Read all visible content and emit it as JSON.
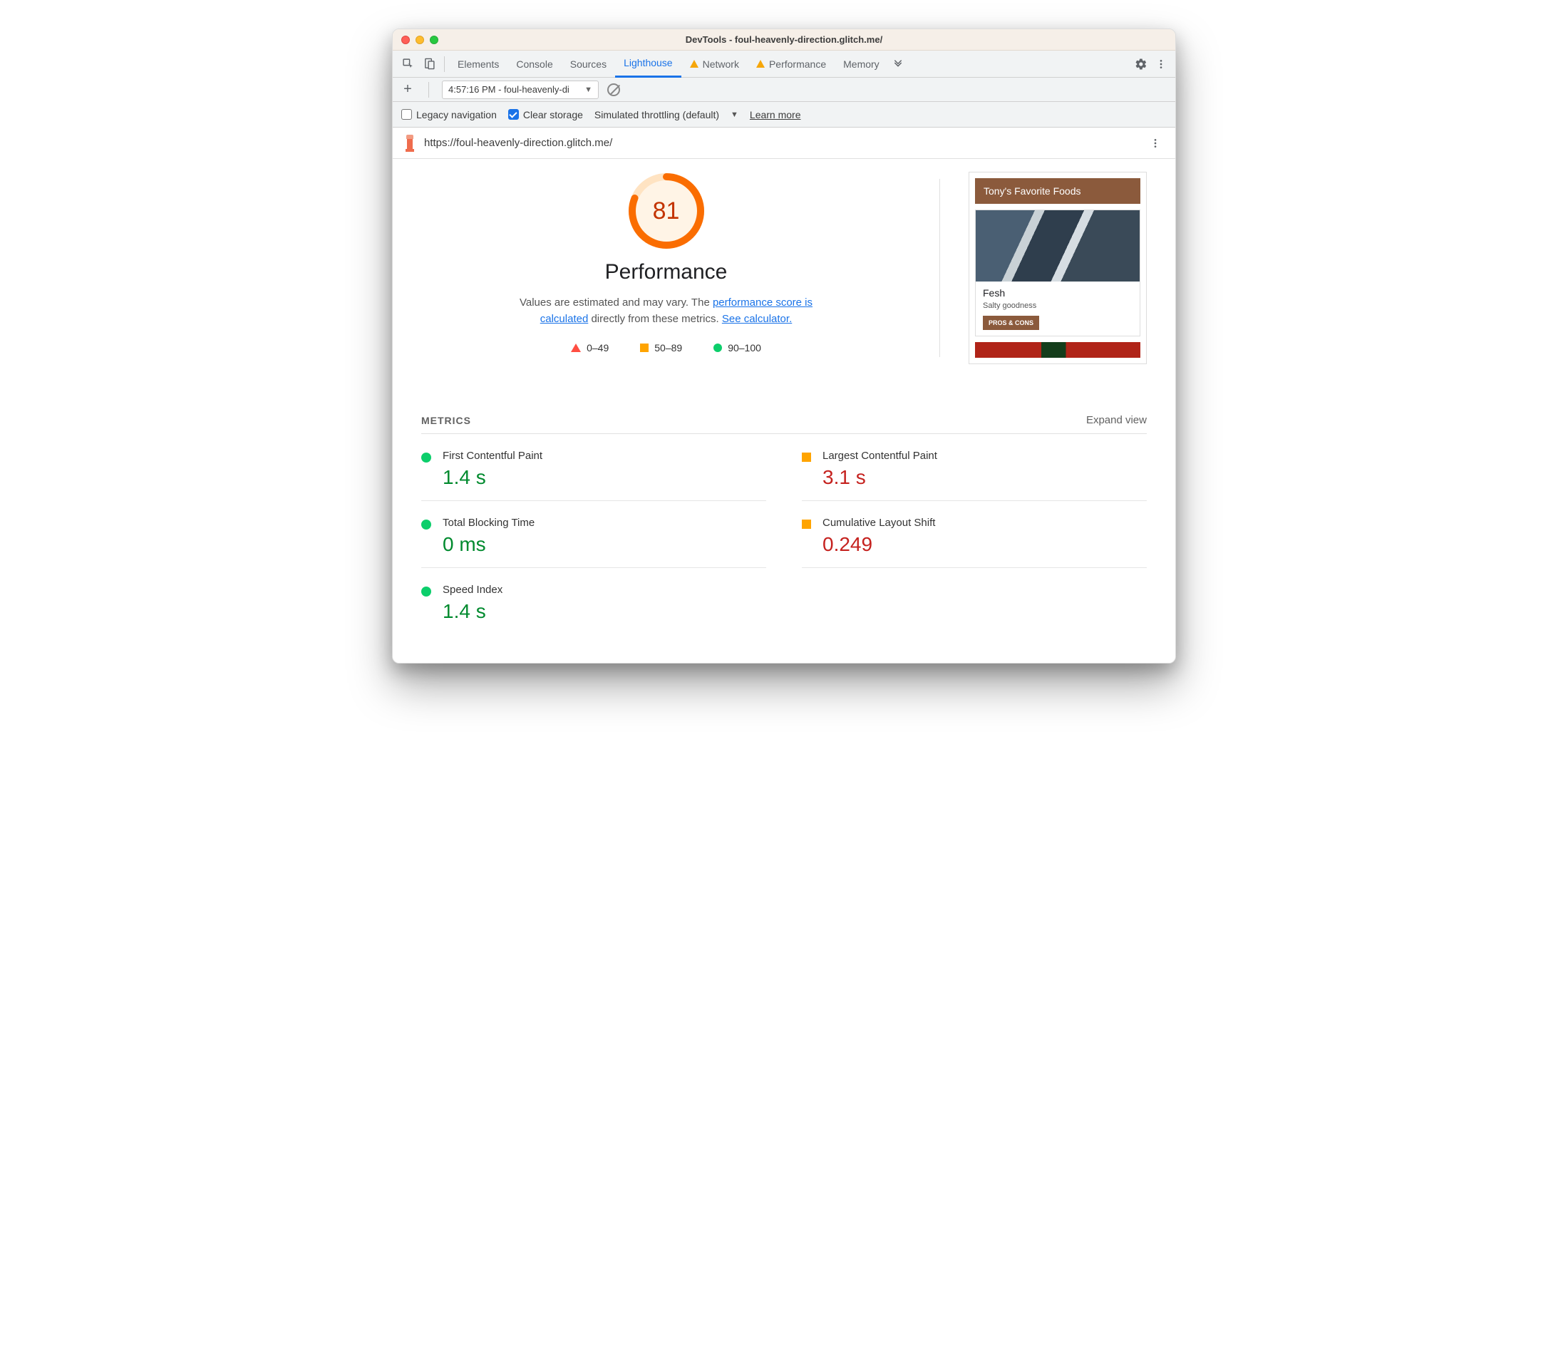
{
  "window": {
    "title": "DevTools - foul-heavenly-direction.glitch.me/"
  },
  "tabs": {
    "items": [
      "Elements",
      "Console",
      "Sources",
      "Lighthouse",
      "Network",
      "Performance",
      "Memory"
    ],
    "active": "Lighthouse",
    "warn": [
      "Network",
      "Performance"
    ]
  },
  "toolbar": {
    "run_label": "4:57:16 PM - foul-heavenly-di"
  },
  "options": {
    "legacy_label": "Legacy navigation",
    "legacy_checked": false,
    "clear_label": "Clear storage",
    "clear_checked": true,
    "throttle_label": "Simulated throttling (default)",
    "learn_more": "Learn more"
  },
  "urlbar": {
    "url": "https://foul-heavenly-direction.glitch.me/"
  },
  "gauge": {
    "score": "81",
    "pct": 0.81
  },
  "perf": {
    "title": "Performance",
    "desc_1": "Values are estimated and may vary. The ",
    "link_1": "performance score is calculated",
    "desc_2": " directly from these metrics. ",
    "link_2": "See calculator."
  },
  "legend": {
    "bad": "0–49",
    "mid": "50–89",
    "good": "90–100"
  },
  "preview": {
    "header": "Tony's Favorite Foods",
    "card_title": "Fesh",
    "card_sub": "Salty goodness",
    "card_btn": "PROS & CONS"
  },
  "metrics": {
    "heading": "METRICS",
    "expand": "Expand view",
    "items": [
      {
        "label": "First Contentful Paint",
        "value": "1.4 s",
        "status": "green"
      },
      {
        "label": "Largest Contentful Paint",
        "value": "3.1 s",
        "status": "amber",
        "vcolor": "red"
      },
      {
        "label": "Total Blocking Time",
        "value": "0 ms",
        "status": "green"
      },
      {
        "label": "Cumulative Layout Shift",
        "value": "0.249",
        "status": "amber",
        "vcolor": "red"
      },
      {
        "label": "Speed Index",
        "value": "1.4 s",
        "status": "green"
      }
    ]
  }
}
